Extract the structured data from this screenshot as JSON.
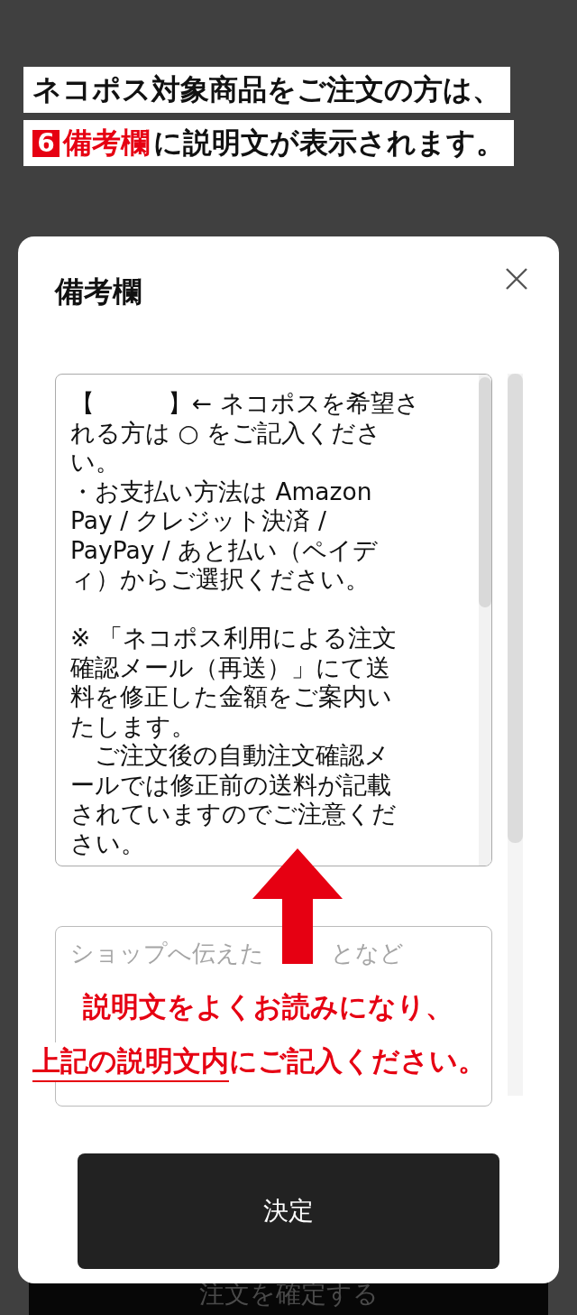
{
  "banner": {
    "line1": "ネコポス対象商品をご注文の方は、",
    "badge": "6",
    "highlight": "備考欄",
    "rest": "に説明文が表示されます。"
  },
  "modal": {
    "title": "備考欄",
    "notes_paragraphs": [
      [
        "【　　　】← ネコポスを希望さ",
        "れる方は ○ をご記入くださ",
        "い。",
        "・お支払い方法は Amazon",
        "Pay / クレジット決済 /",
        "PayPay / あと払い（ペイデ",
        "ィ）からご選択ください。"
      ],
      [
        "※ 「ネコポス利用による注文",
        "確認メール（再送）」にて送",
        "料を修正した金額をご案内い",
        "たします。",
        "　ご注文後の自動注文確認メ",
        "ールでは修正前の送料が記載",
        "されていますのでご注意くだ",
        "さい。"
      ]
    ],
    "placeholder_parts": [
      "ショップへ伝えた",
      "となど"
    ],
    "submit": "決定"
  },
  "callout": {
    "line1": "説明文をよくお読みになり、",
    "underlined": "上記の説明文内",
    "rest": "にご記入ください。"
  },
  "background_button": "注文を確定する"
}
